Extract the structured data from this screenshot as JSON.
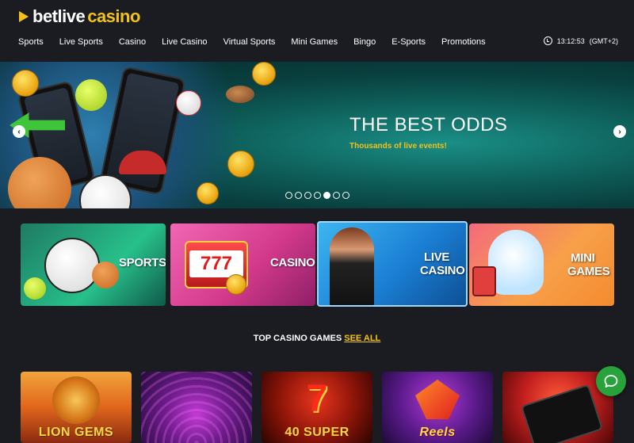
{
  "logo": {
    "part1": "betlive",
    "part2": "casino"
  },
  "nav": [
    "Sports",
    "Live Sports",
    "Casino",
    "Live Casino",
    "Virtual Sports",
    "Mini Games",
    "Bingo",
    "E-Sports",
    "Promotions"
  ],
  "clock": {
    "time": "13:12:53",
    "timezone": "(GMT+2)"
  },
  "banner": {
    "title": "THE BEST ODDS",
    "subtitle": "Thousands of live events!",
    "slide_count": 7,
    "active_slide": 5
  },
  "categories": [
    {
      "label": "SPORTS"
    },
    {
      "label": "CASINO"
    },
    {
      "label_line1": "LIVE",
      "label_line2": "CASINO"
    },
    {
      "label_line1": "MINI",
      "label_line2": "GAMES"
    }
  ],
  "top_games": {
    "heading": "TOP CASINO GAMES",
    "see_all": "SEE ALL"
  },
  "games": [
    {
      "title": "LION GEMS"
    },
    {
      "title": ""
    },
    {
      "title": "40 SUPER"
    },
    {
      "title": "Reels"
    },
    {
      "title": ""
    }
  ],
  "colors": {
    "accent": "#f2c21a",
    "background": "#1b1c22",
    "chat": "#28a23a"
  }
}
